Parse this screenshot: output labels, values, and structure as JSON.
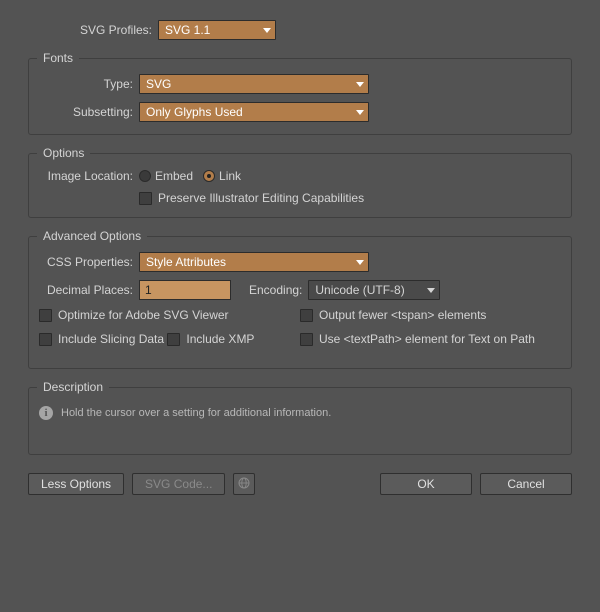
{
  "top": {
    "profiles_label": "SVG Profiles:",
    "profiles_value": "SVG 1.1"
  },
  "fonts": {
    "title": "Fonts",
    "type_label": "Type:",
    "type_value": "SVG",
    "subsetting_label": "Subsetting:",
    "subsetting_value": "Only Glyphs Used"
  },
  "options": {
    "title": "Options",
    "image_loc_label": "Image Location:",
    "embed_label": "Embed",
    "link_label": "Link",
    "preserve_label": "Preserve Illustrator Editing Capabilities"
  },
  "advanced": {
    "title": "Advanced Options",
    "css_label": "CSS Properties:",
    "css_value": "Style Attributes",
    "decimals_label": "Decimal Places:",
    "decimals_value": "1",
    "encoding_label": "Encoding:",
    "encoding_value": "Unicode (UTF-8)",
    "checks": {
      "optimize": "Optimize for Adobe SVG Viewer",
      "output_tspan": "Output fewer <tspan> elements",
      "slicing": "Include Slicing Data",
      "textpath": "Use <textPath> element for Text on Path",
      "xmp": "Include XMP"
    }
  },
  "description": {
    "title": "Description",
    "text": "Hold the cursor over a setting for additional information."
  },
  "buttons": {
    "less_options": "Less Options",
    "svg_code": "SVG Code...",
    "ok": "OK",
    "cancel": "Cancel"
  }
}
